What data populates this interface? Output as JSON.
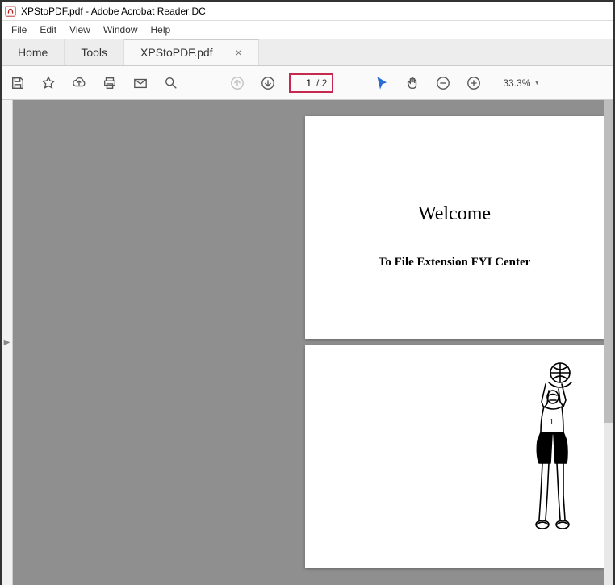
{
  "titlebar": {
    "text": "XPStoPDF.pdf - Adobe Acrobat Reader DC"
  },
  "menubar": {
    "items": [
      "File",
      "Edit",
      "View",
      "Window",
      "Help"
    ]
  },
  "tabbar": {
    "home": "Home",
    "tools": "Tools",
    "doc": "XPStoPDF.pdf"
  },
  "toolbar": {
    "page_current": "1",
    "page_total": "/ 2",
    "zoom": "33.3%"
  },
  "document": {
    "page1_title": "Welcome",
    "page1_sub": "To File Extension FYI Center"
  }
}
